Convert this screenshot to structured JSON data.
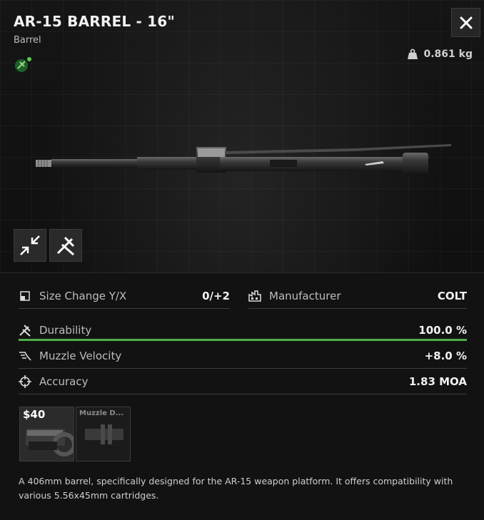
{
  "item": {
    "title": "AR-15 BARREL - 16\"",
    "category": "Barrel",
    "weight": "0.861 kg"
  },
  "stats": {
    "size_change": {
      "label": "Size Change Y/X",
      "value": "0/+2"
    },
    "manufacturer": {
      "label": "Manufacturer",
      "value": "COLT"
    },
    "durability": {
      "label": "Durability",
      "value": "100.0 %",
      "fraction": 1.0
    },
    "muzzle_velocity": {
      "label": "Muzzle Velocity",
      "value": "+8.0 %"
    },
    "accuracy": {
      "label": "Accuracy",
      "value": "1.83 MOA"
    }
  },
  "attachments": [
    {
      "price": "$40",
      "icon": "gas-block-icon"
    },
    {
      "name": "Muzzle D...",
      "icon": "muzzle-device-icon"
    }
  ],
  "description": "A 406mm barrel, specifically designed for the AR-15 weapon platform. It offers compatibility with various 5.56x45mm cartridges.",
  "colors": {
    "accent_green": "#4fae47",
    "background": "#0d0d0d"
  },
  "icons": [
    "close-icon",
    "weight-icon",
    "craftable-icon",
    "collapse-icon",
    "tools-icon",
    "size-icon",
    "factory-icon",
    "durability-icon",
    "velocity-icon",
    "crosshair-icon"
  ]
}
